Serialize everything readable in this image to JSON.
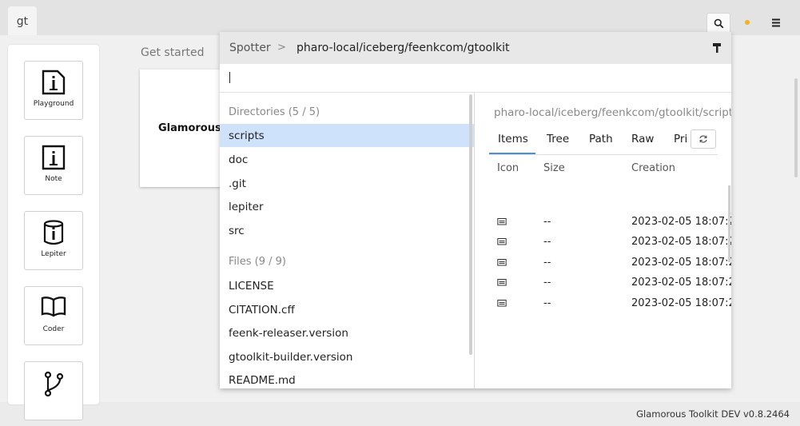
{
  "app": {
    "tab_label": "gt",
    "version": "Glamorous Toolkit DEV v0.8.2464"
  },
  "colors": {
    "accent": "#4a90d9",
    "selection": "#cfe2fb",
    "status_dot": "#f3b21c"
  },
  "sidebar": {
    "tools": [
      {
        "label": "Playground",
        "icon": "playground-icon"
      },
      {
        "label": "Note",
        "icon": "note-icon"
      },
      {
        "label": "Lepiter",
        "icon": "lepiter-icon"
      },
      {
        "label": "Coder",
        "icon": "book-icon"
      },
      {
        "label": "",
        "icon": "git-branch-icon"
      }
    ]
  },
  "main": {
    "section_title": "Get started",
    "card_title": "Glamorous T"
  },
  "spotter": {
    "title": "Spotter",
    "separator": ">",
    "path": "pharo-local/iceberg/feenkcom/gtoolkit",
    "search_value": "",
    "directories_header": "Directories (5 / 5)",
    "directories": [
      "scripts",
      "doc",
      ".git",
      "lepiter",
      "src"
    ],
    "selected_directory": "scripts",
    "files_header": "Files (9 / 9)",
    "files": [
      "LICENSE",
      "CITATION.cff",
      "feenk-releaser.version",
      "gtoolkit-builder.version",
      "README.md"
    ]
  },
  "preview": {
    "path": "pharo-local/iceberg/feenkcom/gtoolkit/scripts",
    "tabs": [
      "Items",
      "Tree",
      "Path",
      "Raw",
      "Pri"
    ],
    "active_tab": "Items",
    "columns": [
      "Icon",
      "Size",
      "Creation"
    ],
    "rows": [
      {
        "icon": "file-icon",
        "size": "--",
        "created": "2023-02-05 18:07:2"
      },
      {
        "icon": "file-icon",
        "size": "--",
        "created": "2023-02-05 18:07:2"
      },
      {
        "icon": "file-icon",
        "size": "--",
        "created": "2023-02-05 18:07:2"
      },
      {
        "icon": "file-icon",
        "size": "--",
        "created": "2023-02-05 18:07:2"
      },
      {
        "icon": "file-icon",
        "size": "--",
        "created": "2023-02-05 18:07:2"
      }
    ]
  }
}
